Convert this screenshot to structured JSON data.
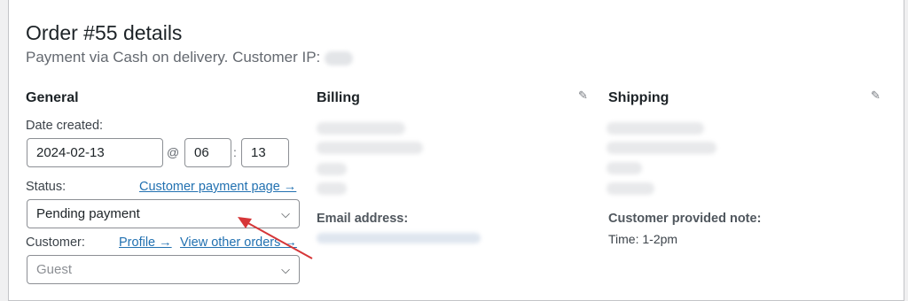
{
  "header": {
    "title": "Order #55 details",
    "subtitle": "Payment via Cash on delivery. Customer IP:"
  },
  "general": {
    "title": "General",
    "date_label": "Date created:",
    "date_value": "2024-02-13",
    "at_symbol": "@",
    "hour_value": "06",
    "time_separator": ":",
    "minute_value": "13",
    "status_label": "Status:",
    "customer_payment_link": "Customer payment page →",
    "status_value": "Pending payment",
    "customer_label": "Customer:",
    "profile_link": "Profile →",
    "view_orders_link": "View other orders →",
    "customer_value": "Guest"
  },
  "billing": {
    "title": "Billing",
    "email_label": "Email address:"
  },
  "shipping": {
    "title": "Shipping",
    "note_label": "Customer provided note:",
    "note_value": "Time: 1-2pm"
  },
  "icons": {
    "edit": "pencil-icon",
    "dropdown": "chevron-down-icon",
    "annotation": "red-arrow"
  },
  "colors": {
    "link": "#2271b1",
    "annotation_arrow": "#d63638"
  }
}
